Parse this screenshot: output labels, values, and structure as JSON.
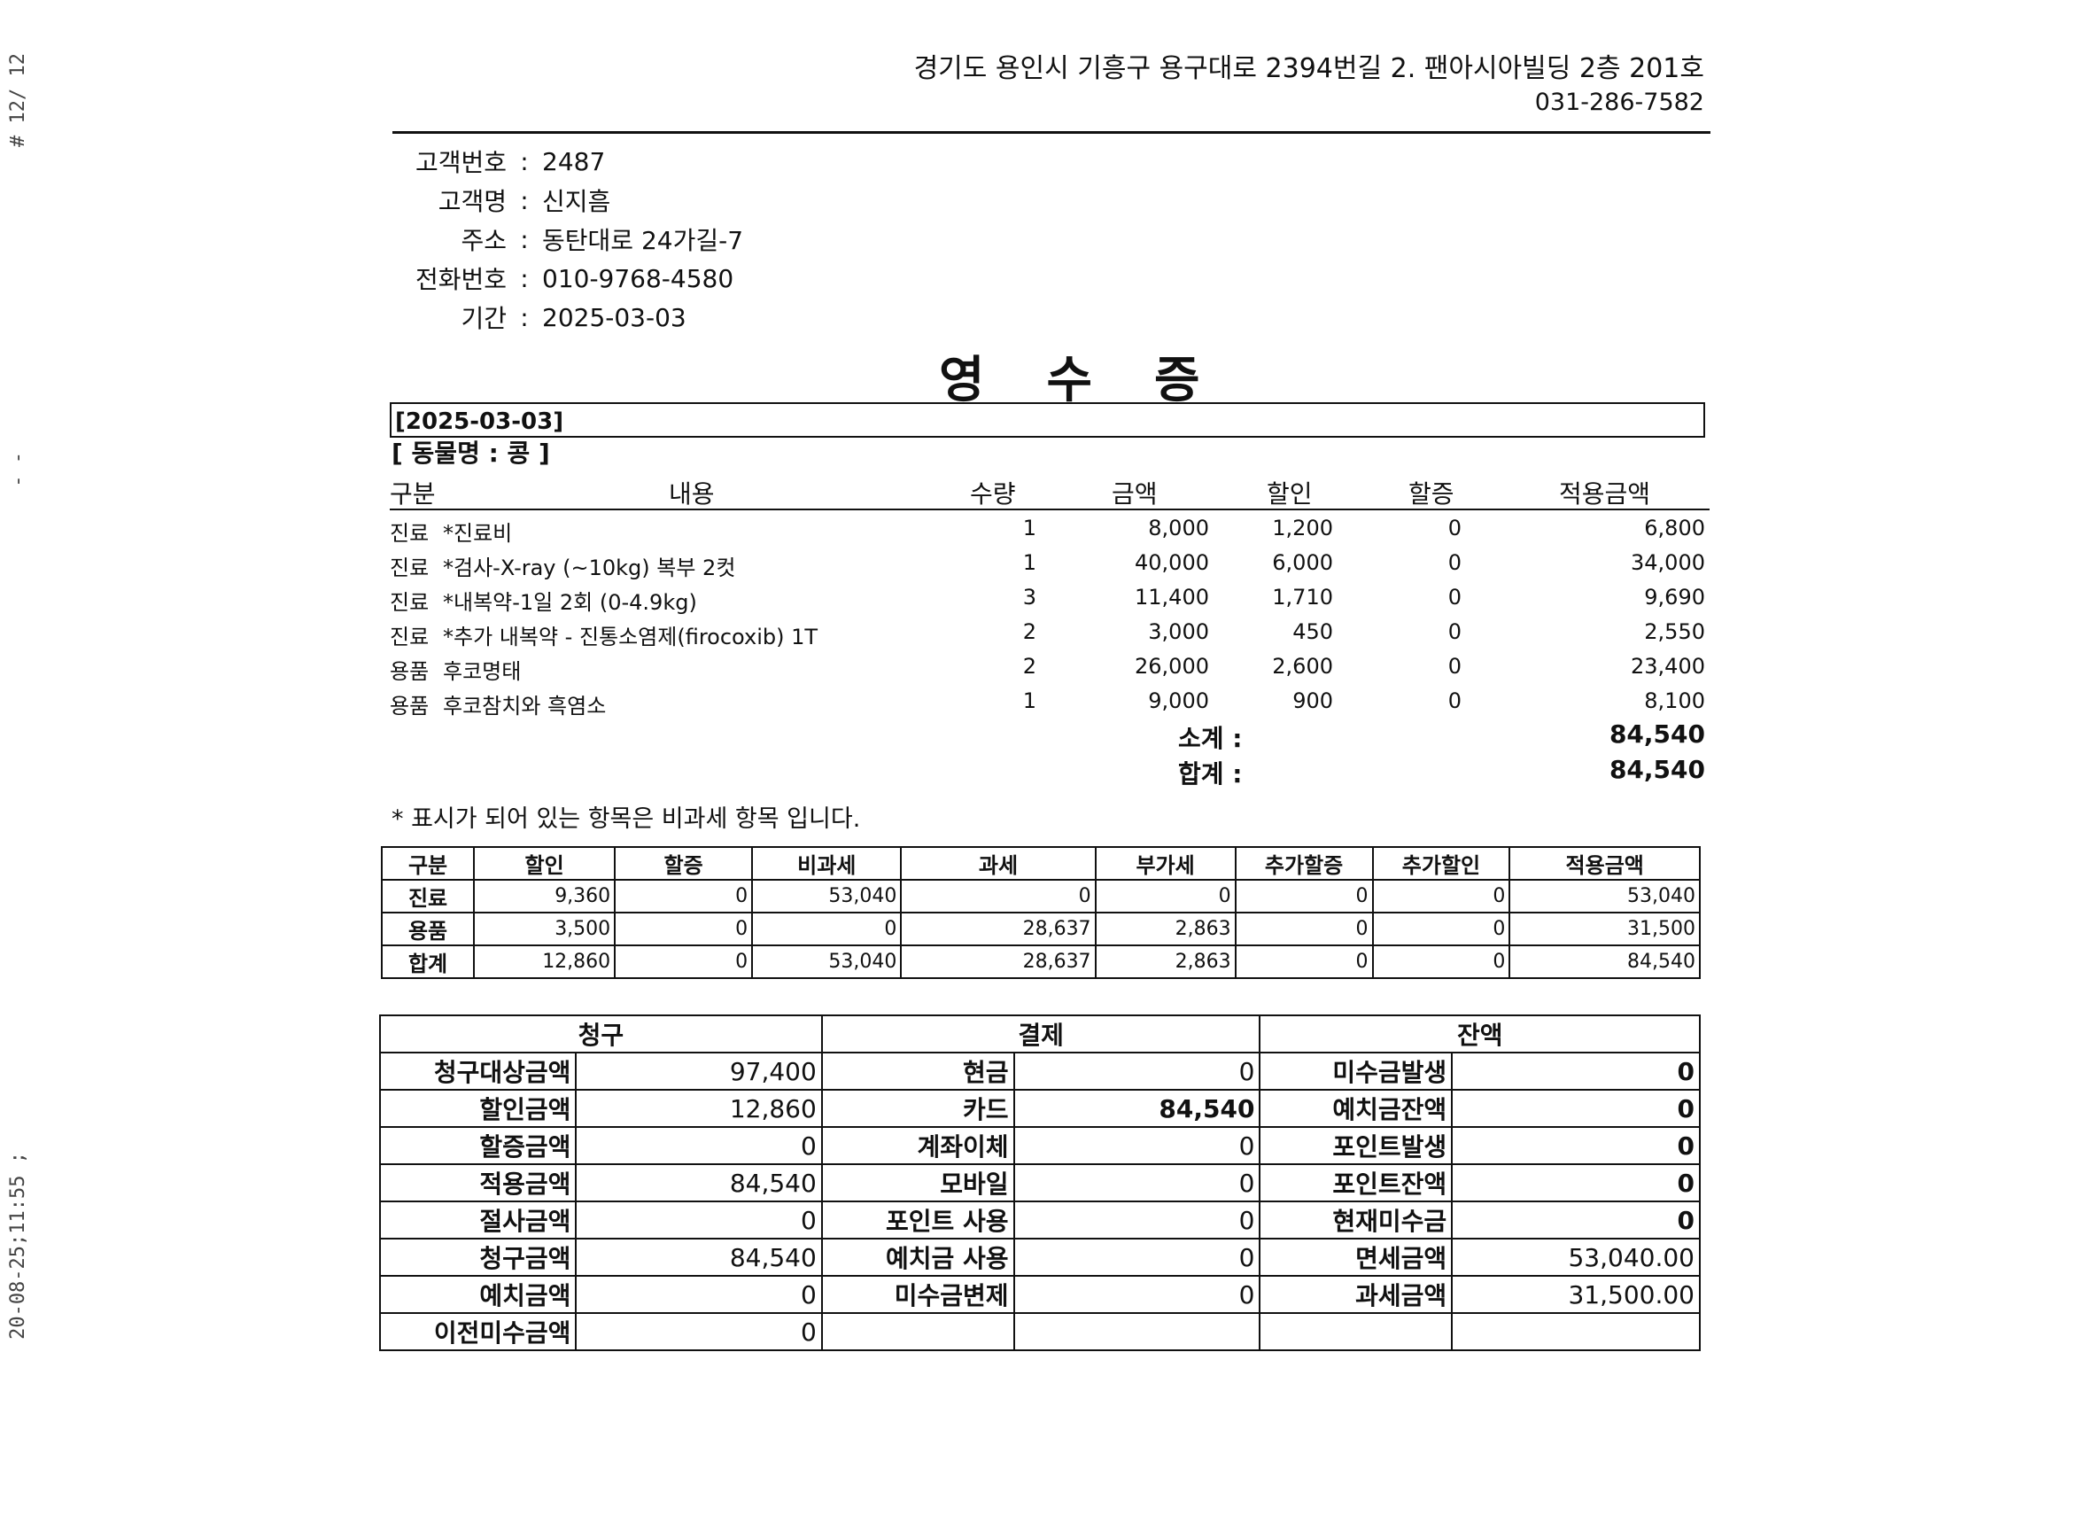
{
  "fax_margin": {
    "top": "# 12/ 12",
    "middle": "- -",
    "bottom": "20-08-25;11:55 ;"
  },
  "clinic": {
    "address": "경기도 용인시 기흥구  용구대로 2394번길 2. 팬아시아빌딩 2층 201호",
    "phone": "031-286-7582"
  },
  "customer": {
    "fields": [
      {
        "label": "고객번호",
        "value": "2487"
      },
      {
        "label": "고객명",
        "value": "신지흠"
      },
      {
        "label": "주소",
        "value": "동탄대로 24가길-7"
      },
      {
        "label": "전화번호",
        "value": "010-9768-4580"
      },
      {
        "label": "기간",
        "value": "2025-03-03"
      }
    ],
    "separator": ":"
  },
  "title": "영수증",
  "visit_date": "[2025-03-03]",
  "animal": "[ 동물명 : 콩 ]",
  "items": {
    "headers": {
      "category": "구분",
      "desc": "내용",
      "qty": "수량",
      "amount": "금액",
      "discount": "할인",
      "surcharge": "할증",
      "applied": "적용금액"
    },
    "rows": [
      {
        "category": "진료",
        "desc": "*진료비",
        "qty": "1",
        "amount": "8,000",
        "discount": "1,200",
        "surcharge": "0",
        "applied": "6,800"
      },
      {
        "category": "진료",
        "desc": "*검사-X-ray (~10kg) 복부 2컷",
        "qty": "1",
        "amount": "40,000",
        "discount": "6,000",
        "surcharge": "0",
        "applied": "34,000"
      },
      {
        "category": "진료",
        "desc": "*내복약-1일 2회 (0-4.9kg)",
        "qty": "3",
        "amount": "11,400",
        "discount": "1,710",
        "surcharge": "0",
        "applied": "9,690"
      },
      {
        "category": "진료",
        "desc": "*추가 내복약 - 진통소염제(firocoxib) 1T",
        "qty": "2",
        "amount": "3,000",
        "discount": "450",
        "surcharge": "0",
        "applied": "2,550"
      },
      {
        "category": "용품",
        "desc": "후코명태",
        "qty": "2",
        "amount": "26,000",
        "discount": "2,600",
        "surcharge": "0",
        "applied": "23,400"
      },
      {
        "category": "용품",
        "desc": "후코참치와 흑염소",
        "qty": "1",
        "amount": "9,000",
        "discount": "900",
        "surcharge": "0",
        "applied": "8,100"
      }
    ]
  },
  "totals": {
    "subtotal_label": "소계 :",
    "subtotal_value": "84,540",
    "total_label": "합계 :",
    "total_value": "84,540"
  },
  "note": "* 표시가 되어 있는 항목은 비과세 항목 입니다.",
  "summary": {
    "headers": [
      "구분",
      "할인",
      "할증",
      "비과세",
      "과세",
      "부가세",
      "추가할증",
      "추가할인",
      "적용금액"
    ],
    "rows": [
      [
        "진료",
        "9,360",
        "0",
        "53,040",
        "0",
        "0",
        "0",
        "0",
        "53,040"
      ],
      [
        "용품",
        "3,500",
        "0",
        "0",
        "28,637",
        "2,863",
        "0",
        "0",
        "31,500"
      ],
      [
        "합계",
        "12,860",
        "0",
        "53,040",
        "28,637",
        "2,863",
        "0",
        "0",
        "84,540"
      ]
    ]
  },
  "payment": {
    "headers": [
      "청구",
      "결제",
      "잔액"
    ],
    "rows": [
      [
        "청구대상금액",
        "97,400",
        "현금",
        "0",
        "미수금발생",
        "0"
      ],
      [
        "할인금액",
        "12,860",
        "카드",
        "84,540",
        "예치금잔액",
        "0"
      ],
      [
        "할증금액",
        "0",
        "계좌이체",
        "0",
        "포인트발생",
        "0"
      ],
      [
        "적용금액",
        "84,540",
        "모바일",
        "0",
        "포인트잔액",
        "0"
      ],
      [
        "절사금액",
        "0",
        "포인트 사용",
        "0",
        "현재미수금",
        "0"
      ],
      [
        "청구금액",
        "84,540",
        "예치금 사용",
        "0",
        "면세금액",
        "53,040.00"
      ],
      [
        "예치금액",
        "0",
        "미수금변제",
        "0",
        "과세금액",
        "31,500.00"
      ],
      [
        "이전미수금액",
        "0",
        "",
        "",
        "",
        ""
      ]
    ]
  }
}
